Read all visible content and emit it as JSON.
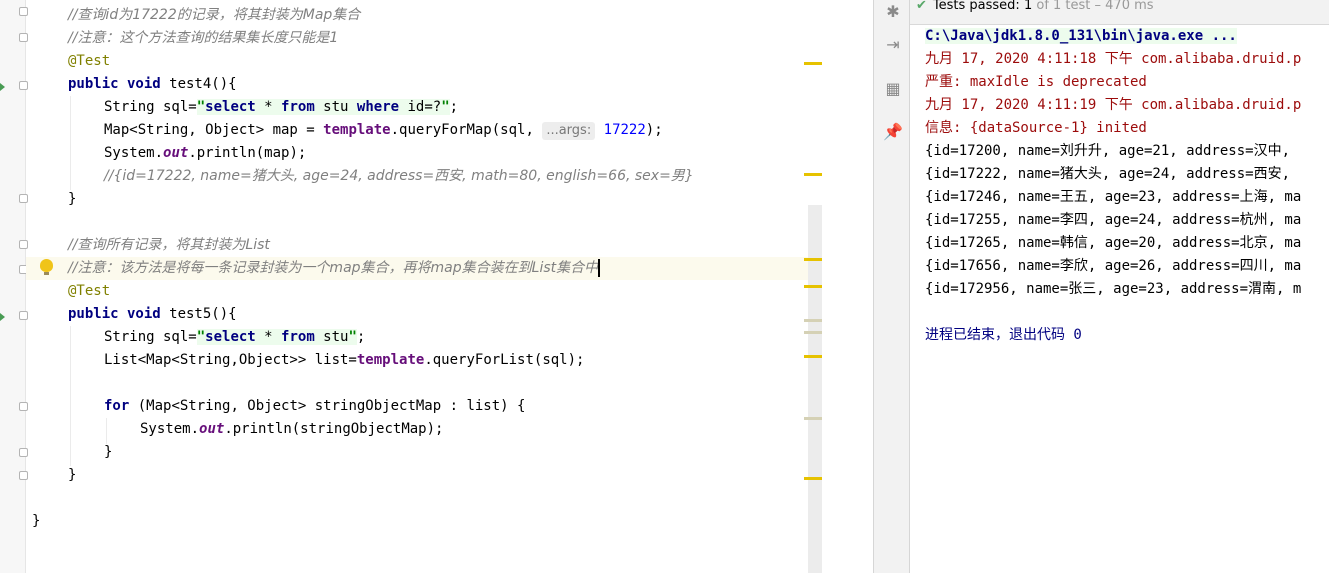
{
  "editor": {
    "lines": {
      "l1": "//查询id为17222的记录，将其封装为Map集合",
      "l2": "//注意：这个方法查询的结果集长度只能是1",
      "l3": "@Test",
      "l4_kw": "public void",
      "l4_rest": " test4(){",
      "l5_type": "String sql=",
      "l5_q1": "\"",
      "l5_select": "select",
      "l5_star": " * ",
      "l5_from": "from",
      "l5_stu": " stu ",
      "l5_where": "where",
      "l5_cond": " id=?",
      "l5_q2": "\"",
      "l5_end": ";",
      "l6_a": "Map<String, Object> map = ",
      "l6_template": "template",
      "l6_b": ".queryForMap(sql, ",
      "l6_hint": "...args:",
      "l6_num": "17222",
      "l6_end": ");",
      "l7_a": "System.",
      "l7_out": "out",
      "l7_b": ".println(map);",
      "l8": "//{id=17222, name=猪大头, age=24, address=西安, math=80, english=66, sex=男}",
      "l9": "}",
      "l10": "//查询所有记录，将其封装为List",
      "l11": "//注意：该方法是将每一条记录封装为一个map集合，再将map集合装在到List集合中",
      "l12": "@Test",
      "l13_kw": "public void",
      "l13_rest": " test5(){",
      "l14_type": "String sql=",
      "l14_q1": "\"",
      "l14_select": "select",
      "l14_star": " * ",
      "l14_from": "from",
      "l14_stu": " stu",
      "l14_q2": "\"",
      "l14_end": ";",
      "l15_a": "List<Map<String,Object>> list=",
      "l15_template": "template",
      "l15_b": ".queryForList(sql);",
      "l16_for": "for",
      "l16_rest": " (Map<String, Object> stringObjectMap : list) {",
      "l17_a": "System.",
      "l17_out": "out",
      "l17_b": ".println(stringObjectMap);",
      "l18": "}",
      "l19": "}",
      "l20": "}"
    }
  },
  "run_panel": {
    "status_label": "Tests passed: 1",
    "status_detail": "of 1 test – 470 ms",
    "tool_icons": [
      "debug-icon",
      "exit-icon",
      "layout-icon",
      "pin-icon"
    ]
  },
  "console": {
    "lines": [
      {
        "text": "C:\\Java\\jdk1.8.0_131\\bin\\java.exe ...",
        "style": "path"
      },
      {
        "text": "九月 17, 2020 4:11:18 下午 com.alibaba.druid.p",
        "style": "red"
      },
      {
        "text": "严重: maxIdle is deprecated",
        "style": "red"
      },
      {
        "text": "九月 17, 2020 4:11:19 下午 com.alibaba.druid.p",
        "style": "red"
      },
      {
        "text": "信息: {dataSource-1} inited",
        "style": "red"
      },
      {
        "text": "{id=17200, name=刘升升, age=21, address=汉中,",
        "style": "normal"
      },
      {
        "text": "{id=17222, name=猪大头, age=24, address=西安,",
        "style": "normal"
      },
      {
        "text": "{id=17246, name=王五, age=23, address=上海, ma",
        "style": "normal"
      },
      {
        "text": "{id=17255, name=李四, age=24, address=杭州, ma",
        "style": "normal"
      },
      {
        "text": "{id=17265, name=韩信, age=20, address=北京, ma",
        "style": "normal"
      },
      {
        "text": "{id=17656, name=李欣, age=26, address=四川, ma",
        "style": "normal"
      },
      {
        "text": "{id=172956, name=张三, age=23, address=渭南, m",
        "style": "normal"
      },
      {
        "text": "",
        "style": "normal"
      },
      {
        "text": "进程已结束，退出代码 0",
        "style": "exit"
      }
    ]
  },
  "colors": {
    "keyword": "#000080",
    "string": "#008000",
    "comment": "#808080",
    "annotation": "#808000",
    "error": "#9c0b0b",
    "marker": "#e6c200",
    "passed": "#59a869"
  }
}
